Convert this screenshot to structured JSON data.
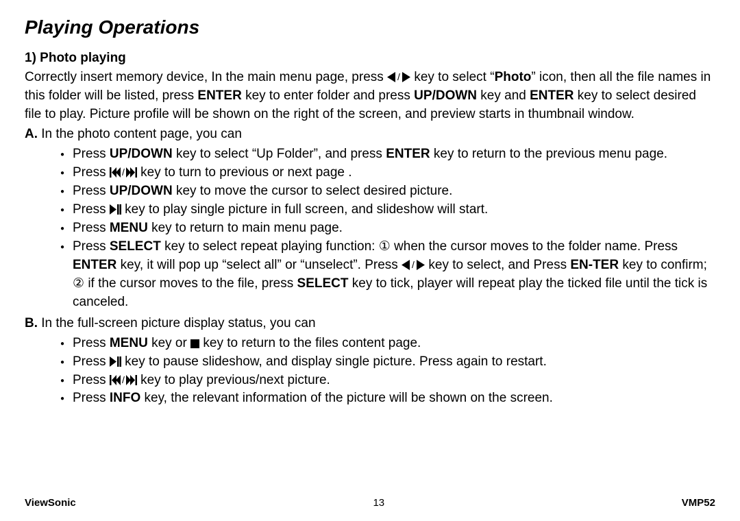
{
  "title": "Playing Operations",
  "subheading": "1) Photo playing",
  "intro": {
    "pre": "Correctly insert memory device, In the main menu page, press ",
    "icon_lr": "◀ / ▶",
    "mid1": " key to select “",
    "photo": "Photo",
    "mid2": "” icon, then all the file names in this folder will be listed, press ",
    "enter1": "ENTER",
    "mid3": " key to enter folder and press ",
    "updown1": "UP/DOWN",
    "mid4": " key and ",
    "enter2": "ENTER",
    "mid5": " key to select desired file to play. Picture profile will be shown on the right of the screen, and preview starts in thumbnail window."
  },
  "secA": {
    "label": "A.",
    "text": " In the photo content page, you can",
    "items": {
      "i1": {
        "p1": "Press ",
        "updown": "UP/DOWN",
        "p2": " key to select “Up Folder”, and press ",
        "enter": "ENTER",
        "p3": " key to return to the previous menu page."
      },
      "i2": {
        "p1": "Press ",
        "icon": "⏮ / ⏭",
        "p2": " key to turn to previous or next page ."
      },
      "i3": {
        "p1": "Press ",
        "updown": "UP/DOWN",
        "p2": " key to move the cursor to select desired picture."
      },
      "i4": {
        "p1": "Press ",
        "icon": "⏯",
        "p2": " key to play single picture in full screen, and slideshow will start."
      },
      "i5": {
        "p1": "Press ",
        "menu": "MENU",
        "p2": " key to return to main menu page."
      },
      "i6": {
        "p1": "Press ",
        "select": "SELECT",
        "p2": " key to select repeat playing function: ",
        "c1": "①",
        "p3": " when the cursor moves to the folder name. Press ",
        "enter1": "ENTER",
        "p4": " key, it will pop up “select all” or “unselect”. Press ",
        "icon_lr": "◀ / ▶",
        "p5": " key to select, and Press ",
        "enter2": "EN-TER",
        "p6": " key to confirm; ",
        "c2": "②",
        "p7": " if the cursor moves to the file, press ",
        "select2": "SELECT",
        "p8": " key to tick, player will repeat play the ticked file until the tick is canceled."
      }
    }
  },
  "secB": {
    "label": "B.",
    "text": " In the full-screen picture display status, you can",
    "items": {
      "i1": {
        "p1": "Press ",
        "menu": "MENU",
        "p2": " key or ",
        "icon": "■",
        "p3": " key to return to the files content page."
      },
      "i2": {
        "p1": "Press ",
        "icon": "⏯",
        "p2": " key to pause slideshow, and display single picture. Press again to restart."
      },
      "i3": {
        "p1": "Press ",
        "icon": "⏮ / ⏭",
        "p2": " key to play previous/next picture."
      },
      "i4": {
        "p1": "Press ",
        "info": "INFO",
        "p2": " key, the relevant information of the picture will be shown on the screen."
      }
    }
  },
  "footer": {
    "left": "ViewSonic",
    "center": "13",
    "right": "VMP52"
  }
}
